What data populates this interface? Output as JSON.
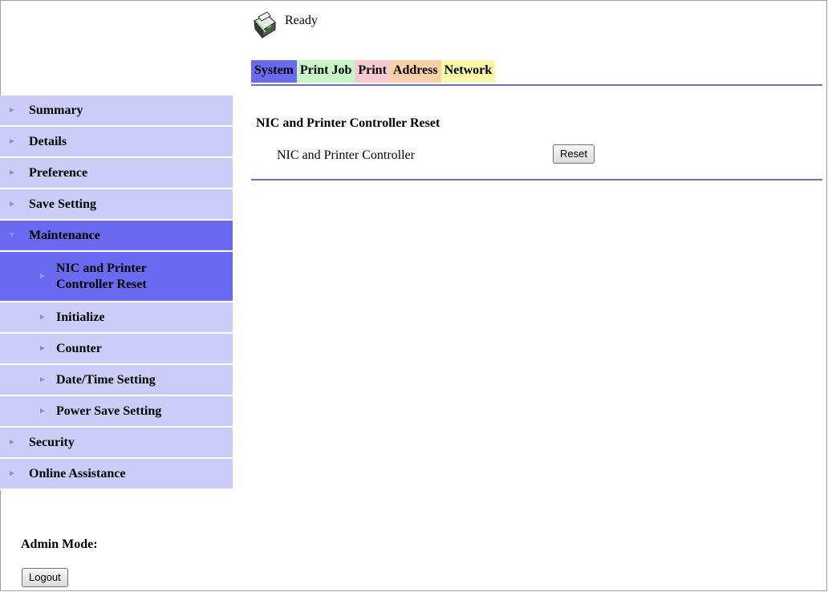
{
  "header": {
    "status_icon": "printer-status-icon",
    "status_text": "Ready"
  },
  "tabs": [
    {
      "label": "System",
      "color": "#6a6af0",
      "active": true
    },
    {
      "label": "Print Job",
      "color": "#c6f5c6"
    },
    {
      "label": "Print",
      "color": "#f5c9cf"
    },
    {
      "label": "Address",
      "color": "#f8cfa6"
    },
    {
      "label": "Network",
      "color": "#f8f8a8"
    }
  ],
  "sidebar": {
    "items": [
      {
        "label": "Summary"
      },
      {
        "label": "Details"
      },
      {
        "label": "Preference"
      },
      {
        "label": "Save Setting"
      },
      {
        "label": "Maintenance",
        "expanded": true
      },
      {
        "label": "Security"
      },
      {
        "label": "Online Assistance"
      }
    ],
    "maintenance_sub": [
      {
        "label_line1": "NIC and Printer",
        "label_line2": "Controller Reset",
        "active": true
      },
      {
        "label": "Initialize"
      },
      {
        "label": "Counter"
      },
      {
        "label": "Date/Time Setting"
      },
      {
        "label": "Power Save Setting"
      }
    ],
    "accent_color": "#6a6af0",
    "item_color": "#ccccf8"
  },
  "admin": {
    "label": "Admin Mode:",
    "logout_label": "Logout"
  },
  "content": {
    "section_title": "NIC and Printer Controller Reset",
    "row_label": "NIC and Printer Controller",
    "reset_label": "Reset"
  }
}
